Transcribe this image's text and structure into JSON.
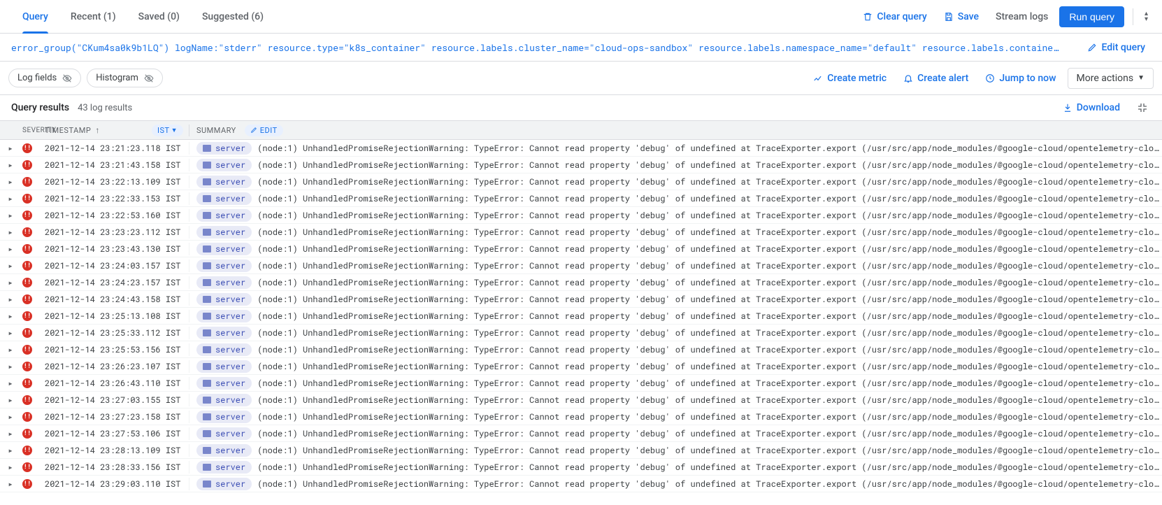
{
  "tabs": {
    "query": "Query",
    "recent": "Recent (1)",
    "saved": "Saved (0)",
    "suggested": "Suggested (6)"
  },
  "actions": {
    "clear_query": "Clear query",
    "save": "Save",
    "stream_logs": "Stream logs",
    "run_query": "Run query",
    "edit_query": "Edit query"
  },
  "query_string": "error_group(\"CKum4sa0k9b1LQ\") logName:\"stderr\" resource.type=\"k8s_container\" resource.labels.cluster_name=\"cloud-ops-sandbox\" resource.labels.namespace_name=\"default\" resource.labels.containe…",
  "toolbar": {
    "log_fields": "Log fields",
    "histogram": "Histogram",
    "create_metric": "Create metric",
    "create_alert": "Create alert",
    "jump_to_now": "Jump to now",
    "more_actions": "More actions"
  },
  "results": {
    "title": "Query results",
    "count": "43 log results",
    "download": "Download"
  },
  "columns": {
    "severity": "Severity",
    "timestamp": "Timestamp",
    "tz": "IST",
    "summary": "Summary",
    "edit": "EDIT"
  },
  "log_container_label": "server",
  "log_message": "(node:1) UnhandledPromiseRejectionWarning: TypeError: Cannot read property 'debug' of undefined at TraceExporter.export (/usr/src/app/node_modules/@google-cloud/opentelemetry-cloud-t…",
  "logs": [
    {
      "ts": "2021-12-14 23:21:23.118 IST"
    },
    {
      "ts": "2021-12-14 23:21:43.158 IST"
    },
    {
      "ts": "2021-12-14 23:22:13.109 IST"
    },
    {
      "ts": "2021-12-14 23:22:33.153 IST"
    },
    {
      "ts": "2021-12-14 23:22:53.160 IST"
    },
    {
      "ts": "2021-12-14 23:23:23.112 IST"
    },
    {
      "ts": "2021-12-14 23:23:43.130 IST"
    },
    {
      "ts": "2021-12-14 23:24:03.157 IST"
    },
    {
      "ts": "2021-12-14 23:24:23.157 IST"
    },
    {
      "ts": "2021-12-14 23:24:43.158 IST"
    },
    {
      "ts": "2021-12-14 23:25:13.108 IST"
    },
    {
      "ts": "2021-12-14 23:25:33.112 IST"
    },
    {
      "ts": "2021-12-14 23:25:53.156 IST"
    },
    {
      "ts": "2021-12-14 23:26:23.107 IST"
    },
    {
      "ts": "2021-12-14 23:26:43.110 IST"
    },
    {
      "ts": "2021-12-14 23:27:03.155 IST"
    },
    {
      "ts": "2021-12-14 23:27:23.158 IST"
    },
    {
      "ts": "2021-12-14 23:27:53.106 IST"
    },
    {
      "ts": "2021-12-14 23:28:13.109 IST"
    },
    {
      "ts": "2021-12-14 23:28:33.156 IST"
    },
    {
      "ts": "2021-12-14 23:29:03.110 IST"
    }
  ]
}
